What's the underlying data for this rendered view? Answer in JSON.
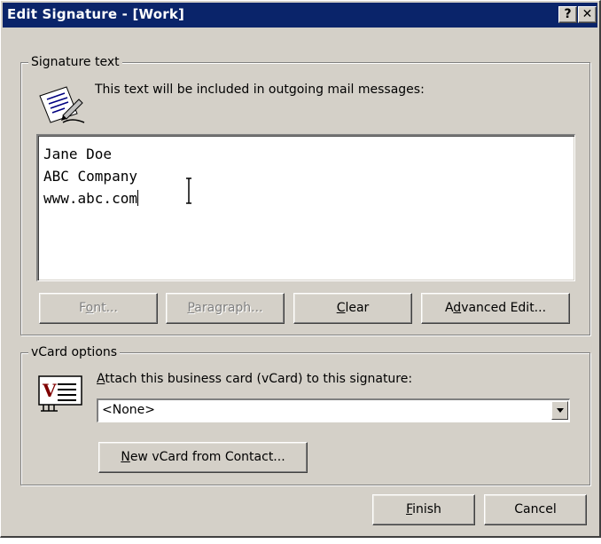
{
  "window": {
    "title": "Edit Signature - [Work]",
    "help_glyph": "?",
    "close_glyph": "✕"
  },
  "signature_group": {
    "legend": "Signature text",
    "description": "This text will be included in outgoing mail messages:",
    "icon": "signature-pen-icon",
    "lines": [
      "Jane Doe",
      "ABC Company",
      "www.abc.com"
    ],
    "buttons": {
      "font": {
        "pre": "F",
        "u": "o",
        "post": "nt..."
      },
      "paragraph": {
        "pre": "",
        "u": "P",
        "post": "aragraph..."
      },
      "clear": {
        "pre": "",
        "u": "C",
        "post": "lear"
      },
      "advanced": {
        "pre": "A",
        "u": "d",
        "post": "vanced Edit..."
      }
    }
  },
  "vcard_group": {
    "legend": "vCard options",
    "icon": "vcard-icon",
    "attach_label": {
      "pre": "",
      "u": "A",
      "post": "ttach this business card (vCard) to this signature:"
    },
    "selected": "<None>",
    "new_vcard": {
      "pre": "",
      "u": "N",
      "post": "ew vCard from Contact..."
    }
  },
  "footer": {
    "finish": {
      "pre": "",
      "u": "F",
      "post": "inish"
    },
    "cancel": "Cancel"
  }
}
